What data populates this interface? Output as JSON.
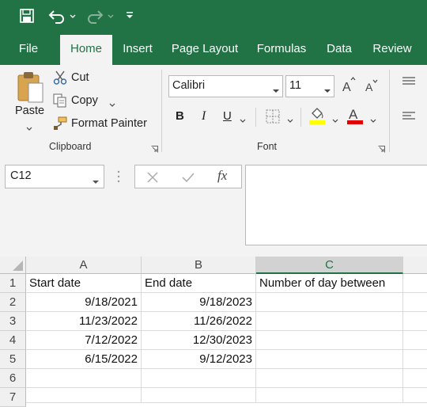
{
  "tabs": [
    {
      "label": "File"
    },
    {
      "label": "Home"
    },
    {
      "label": "Insert"
    },
    {
      "label": "Page Layout"
    },
    {
      "label": "Formulas"
    },
    {
      "label": "Data"
    },
    {
      "label": "Review"
    }
  ],
  "ribbon": {
    "clipboard": {
      "paste_label": "Paste",
      "cut_label": "Cut",
      "copy_label": "Copy",
      "format_painter_label": "Format Painter",
      "group_label": "Clipboard"
    },
    "font": {
      "font_name": "Calibri",
      "font_size": "11",
      "bold": "B",
      "italic": "I",
      "underline": "U",
      "group_label": "Font"
    }
  },
  "formula_bar": {
    "name_box": "C12",
    "fx": "fx",
    "value": ""
  },
  "sheet": {
    "columns": [
      "A",
      "B",
      "C"
    ],
    "rows": [
      "1",
      "2",
      "3",
      "4",
      "5",
      "6",
      "7"
    ],
    "cells": [
      [
        "Start date",
        "End date",
        "Number of day between"
      ],
      [
        "9/18/2021",
        "9/18/2023",
        ""
      ],
      [
        "11/23/2022",
        "11/26/2022",
        ""
      ],
      [
        "7/12/2022",
        "12/30/2023",
        ""
      ],
      [
        "6/15/2022",
        "9/12/2023",
        ""
      ],
      [
        "",
        "",
        ""
      ],
      [
        "",
        "",
        ""
      ]
    ]
  },
  "colors": {
    "accent": "#217346",
    "highlight_yellow": "#ffff00",
    "font_red": "#e00000"
  }
}
